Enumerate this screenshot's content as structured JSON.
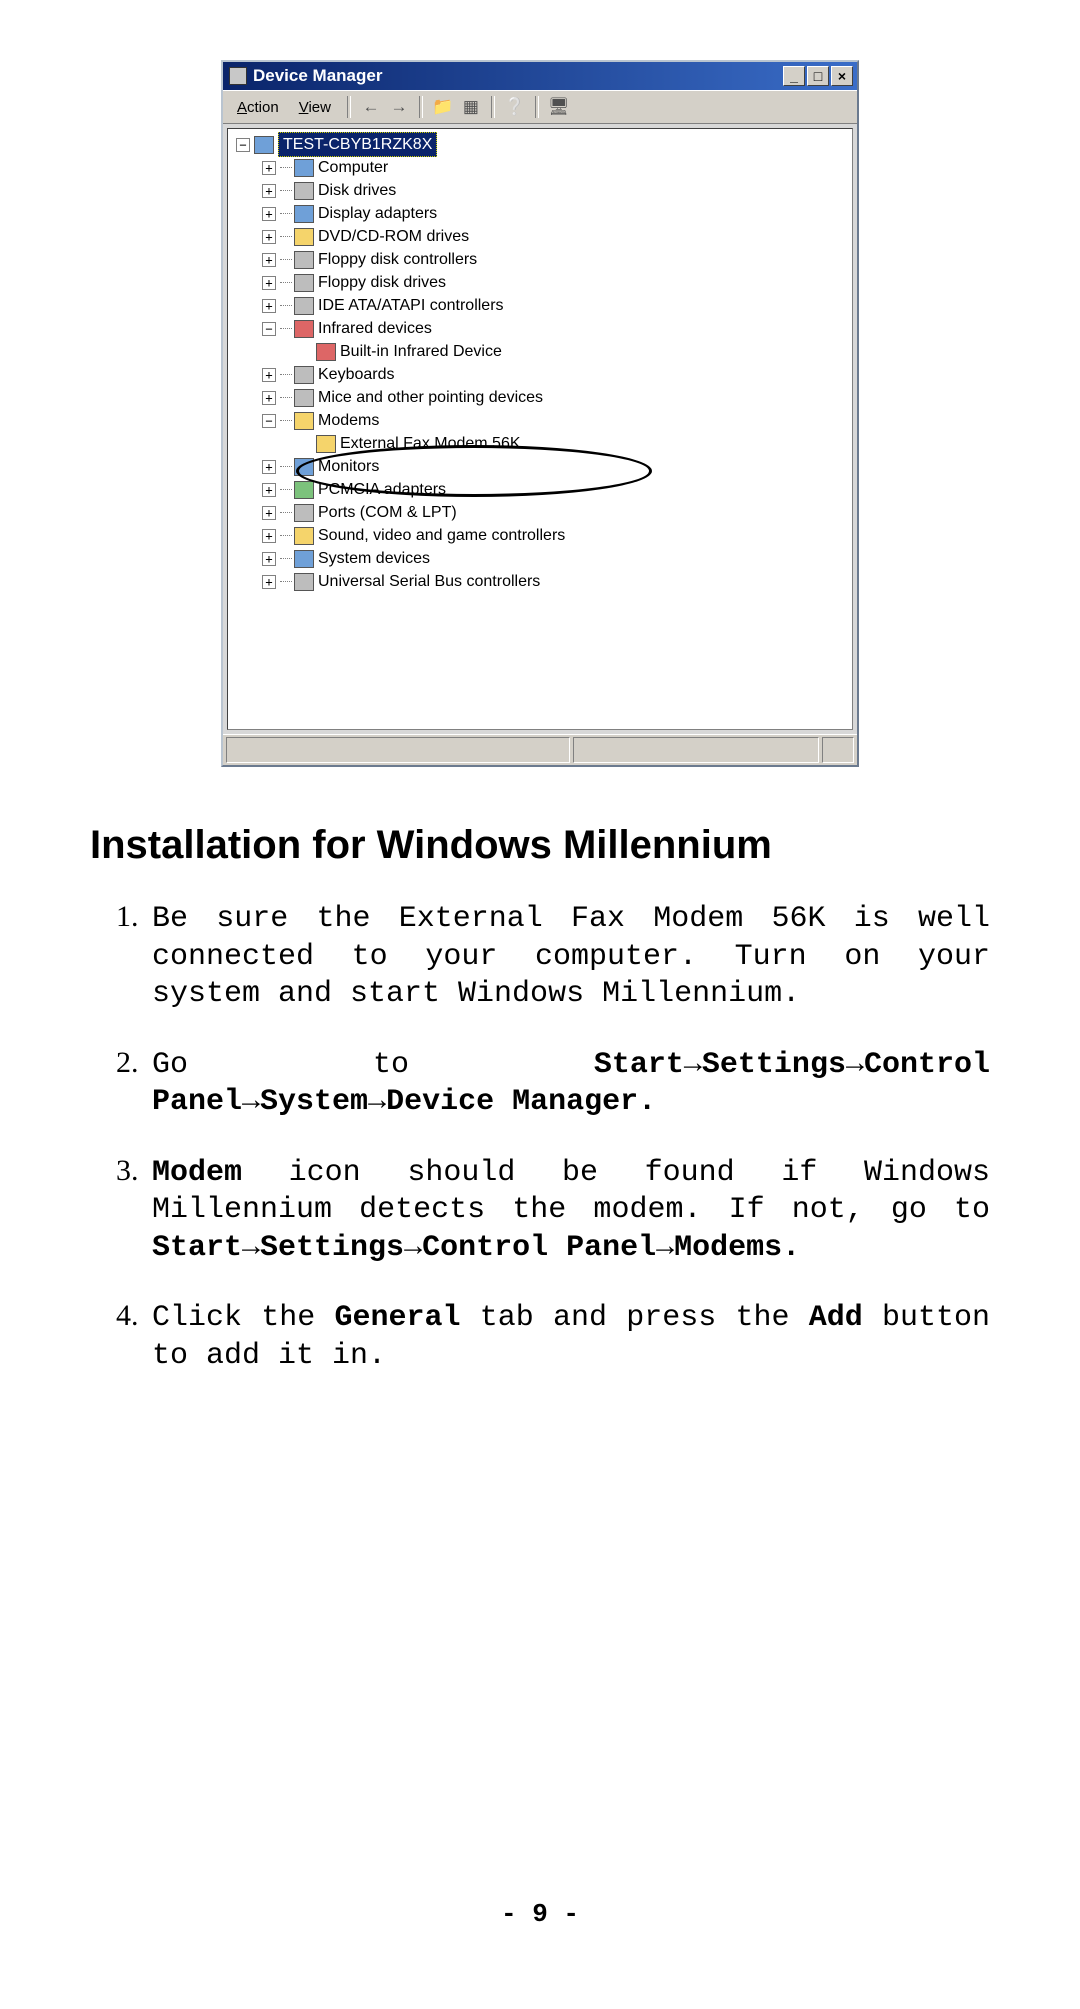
{
  "window": {
    "title": "Device Manager",
    "menu": {
      "action": "Action",
      "view": "View"
    },
    "buttons": {
      "min": "_",
      "max": "□",
      "close": "×"
    }
  },
  "tree": {
    "root": "TEST-CBYB1RZK8X",
    "items": [
      {
        "label": "Computer",
        "expand": "+"
      },
      {
        "label": "Disk drives",
        "expand": "+"
      },
      {
        "label": "Display adapters",
        "expand": "+"
      },
      {
        "label": "DVD/CD-ROM drives",
        "expand": "+"
      },
      {
        "label": "Floppy disk controllers",
        "expand": "+"
      },
      {
        "label": "Floppy disk drives",
        "expand": "+"
      },
      {
        "label": "IDE ATA/ATAPI controllers",
        "expand": "+"
      },
      {
        "label": "Infrared devices",
        "expand": "−",
        "child": "Built-in Infrared Device"
      },
      {
        "label": "Keyboards",
        "expand": "+"
      },
      {
        "label": "Mice and other pointing devices",
        "expand": "+"
      },
      {
        "label": "Modems",
        "expand": "−",
        "child": "External Fax Modem 56K"
      },
      {
        "label": "Monitors",
        "expand": "+"
      },
      {
        "label": "PCMCIA adapters",
        "expand": "+"
      },
      {
        "label": "Ports (COM & LPT)",
        "expand": "+"
      },
      {
        "label": "Sound, video and game controllers",
        "expand": "+"
      },
      {
        "label": "System devices",
        "expand": "+"
      },
      {
        "label": "Universal Serial Bus controllers",
        "expand": "+"
      }
    ]
  },
  "doc": {
    "heading": "Installation for Windows Millennium",
    "step1": "Be sure the External Fax Modem 56K is well connected to your computer. Turn on your system and start Windows Millennium.",
    "step2_a": "Go to ",
    "step2_b": "Start",
    "step2_c": "Settings",
    "step2_d": "Control Panel",
    "step2_e": "System",
    "step2_f": "Device Manager.",
    "step3_a": "Modem",
    "step3_b": " icon should be found if Windows Millennium detects the modem. If not, go to ",
    "step3_c": "Start",
    "step3_d": "Settings",
    "step3_e": "Control Panel",
    "step3_f": "Modems.",
    "step4_a": "Click the ",
    "step4_b": "General",
    "step4_c": " tab and press the ",
    "step4_d": "Add",
    "step4_e": " button to add it in.",
    "arrow": "→",
    "page": "- 9 -"
  }
}
